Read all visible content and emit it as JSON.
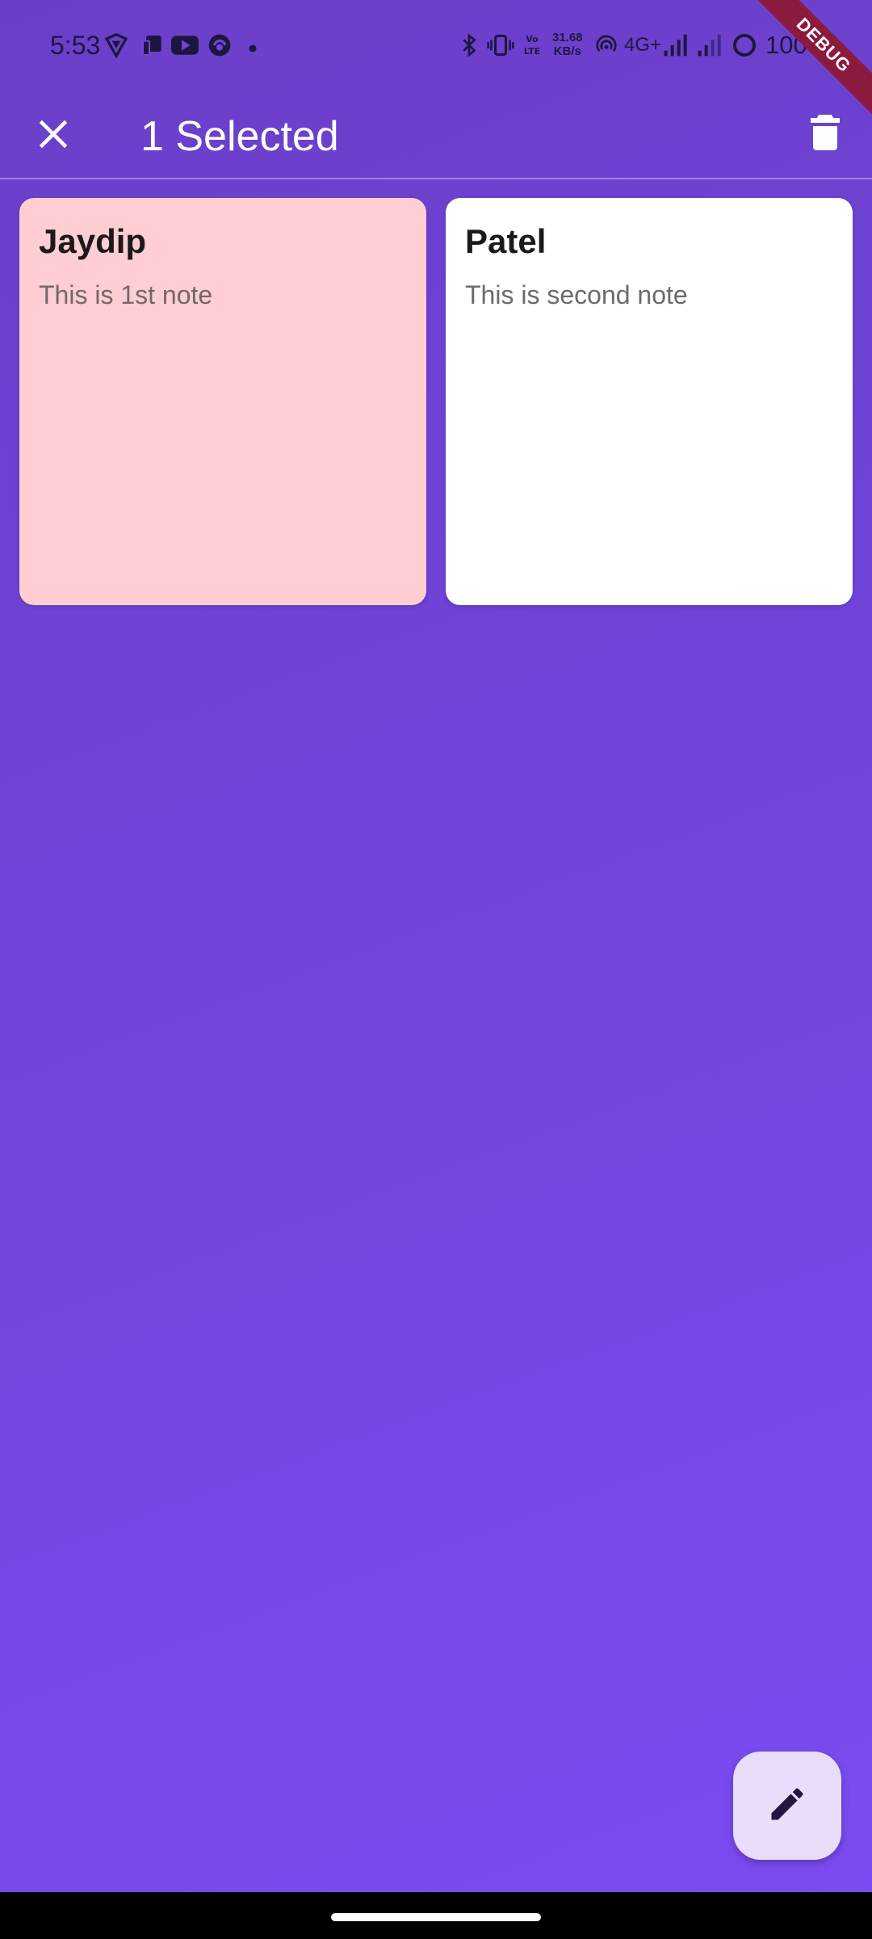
{
  "status_bar": {
    "time": "5:53",
    "speed_value": "31.68",
    "speed_unit": "KB/s",
    "network": "4G+",
    "battery": "100%",
    "icons": [
      "vpn-icon",
      "cast-icon",
      "youtube-icon",
      "browser-icon",
      "dot-icon",
      "bluetooth-icon",
      "vibrate-icon",
      "volte-icon",
      "hotspot-icon",
      "signal-icon",
      "signal-icon-2",
      "battery-ring-icon"
    ]
  },
  "debug_banner": "DEBUG",
  "app_bar": {
    "title": "1 Selected",
    "close_icon": "close-icon",
    "delete_icon": "delete-icon"
  },
  "notes": [
    {
      "title": "Jaydip",
      "body": "This is 1st note",
      "color": "#ffcdd2",
      "selected": true
    },
    {
      "title": "Patel",
      "body": "This is second note",
      "color": "#ffffff",
      "selected": false
    }
  ],
  "fab": {
    "icon": "edit-icon"
  },
  "colors": {
    "background": "#7247dd",
    "fab": "#eadcfb",
    "debug_ribbon": "#8b1a3c"
  }
}
